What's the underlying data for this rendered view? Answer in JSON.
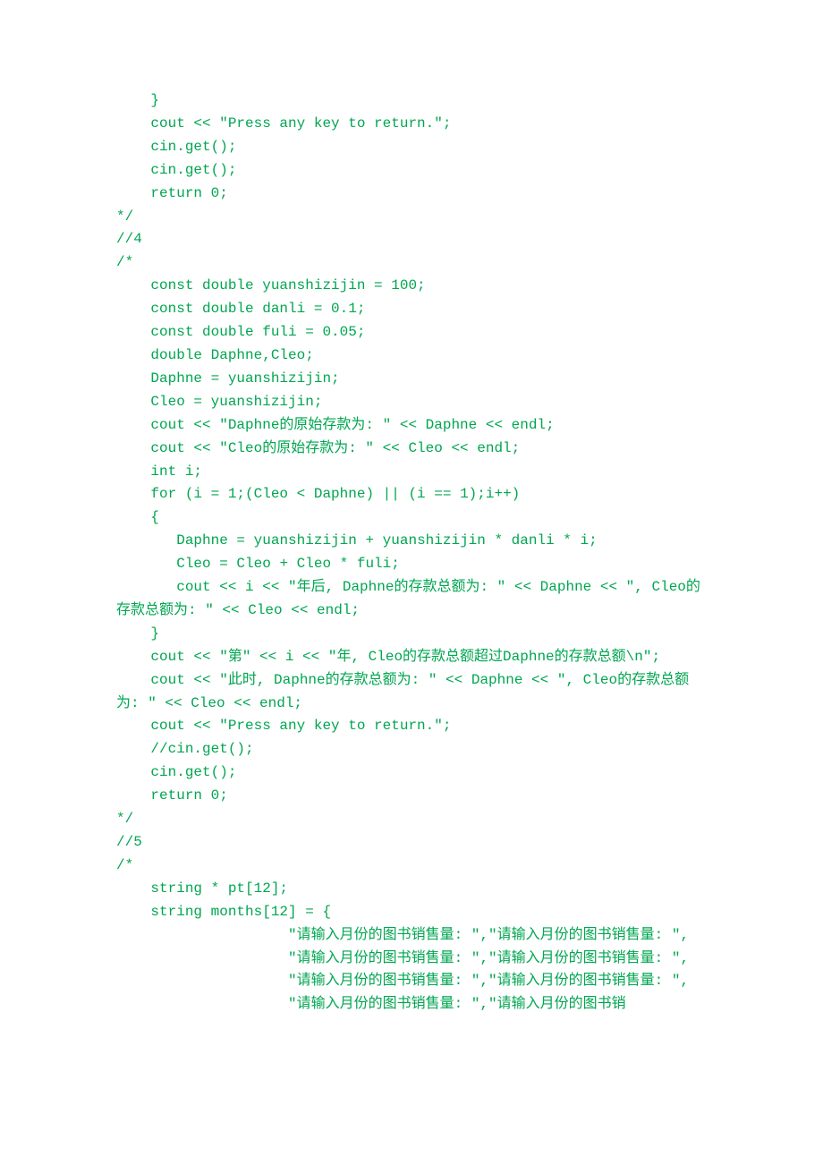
{
  "code": "    }\n    cout << \"Press any key to return.\";\n    cin.get();\n    cin.get();\n    return 0;\n*/\n//4\n/*\n    const double yuanshizijin = 100;\n    const double danli = 0.1;\n    const double fuli = 0.05;\n    double Daphne,Cleo;\n    Daphne = yuanshizijin;\n    Cleo = yuanshizijin;\n    cout << \"Daphne的原始存款为: \" << Daphne << endl;\n    cout << \"Cleo的原始存款为: \" << Cleo << endl;\n    int i;\n    for (i = 1;(Cleo < Daphne) || (i == 1);i++)\n    {\n       Daphne = yuanshizijin + yuanshizijin * danli * i;\n       Cleo = Cleo + Cleo * fuli;\n       cout << i << \"年后, Daphne的存款总额为: \" << Daphne << \", Cleo的存款总额为: \" << Cleo << endl;\n    }\n    cout << \"第\" << i << \"年, Cleo的存款总额超过Daphne的存款总额\\n\";\n    cout << \"此时, Daphne的存款总额为: \" << Daphne << \", Cleo的存款总额为: \" << Cleo << endl;\n    cout << \"Press any key to return.\";\n    //cin.get();\n    cin.get();\n    return 0;\n*/\n//5\n/*\n    string * pt[12];\n    string months[12] = {\n                    \"请输入月份的图书销售量: \",\"请输入月份的图书销售量: \",\n                    \"请输入月份的图书销售量: \",\"请输入月份的图书销售量: \",\n                    \"请输入月份的图书销售量: \",\"请输入月份的图书销售量: \",\n                    \"请输入月份的图书销售量: \",\"请输入月份的图书销"
}
